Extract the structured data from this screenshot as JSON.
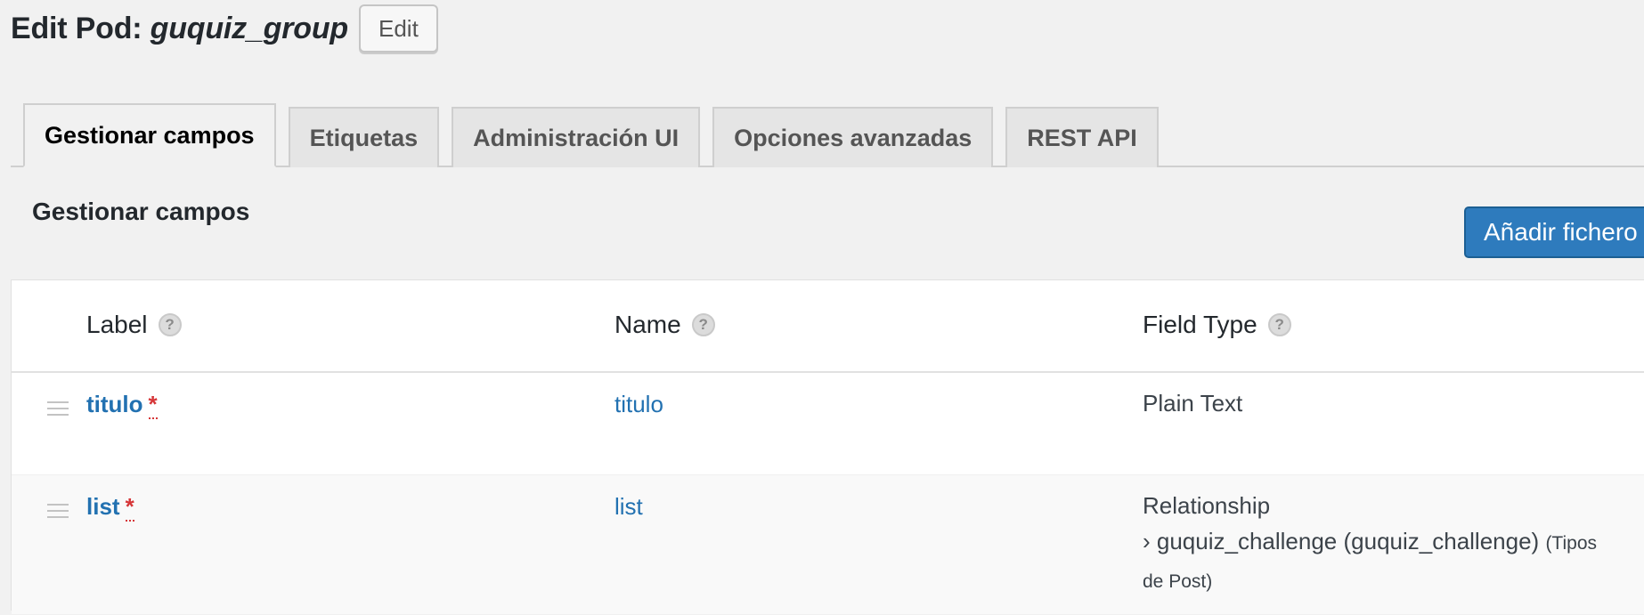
{
  "header": {
    "title_prefix": "Edit Pod: ",
    "pod_name": "guquiz_group",
    "edit_label": "Edit"
  },
  "tabs": [
    {
      "label": "Gestionar campos",
      "active": true
    },
    {
      "label": "Etiquetas",
      "active": false
    },
    {
      "label": "Administración UI",
      "active": false
    },
    {
      "label": "Opciones avanzadas",
      "active": false
    },
    {
      "label": "REST API",
      "active": false
    }
  ],
  "section": {
    "title": "Gestionar campos",
    "add_button_label": "Añadir fichero"
  },
  "table": {
    "columns": [
      {
        "label": "Label",
        "help": "?"
      },
      {
        "label": "Name",
        "help": "?"
      },
      {
        "label": "Field Type",
        "help": "?"
      }
    ],
    "rows": [
      {
        "label": "titulo",
        "required_mark": "*",
        "name": "titulo",
        "type": "Plain Text"
      },
      {
        "label": "list",
        "required_mark": "*",
        "name": "list",
        "type": "Relationship",
        "related": "› guquiz_challenge (guquiz_challenge)",
        "related_kind_line1": "(Tipos",
        "related_kind_line2": "de Post)"
      }
    ]
  },
  "colors": {
    "accent": "#2271b1",
    "button_primary": "#2e7bbd",
    "required": "#d63638",
    "background": "#f1f1f1"
  }
}
